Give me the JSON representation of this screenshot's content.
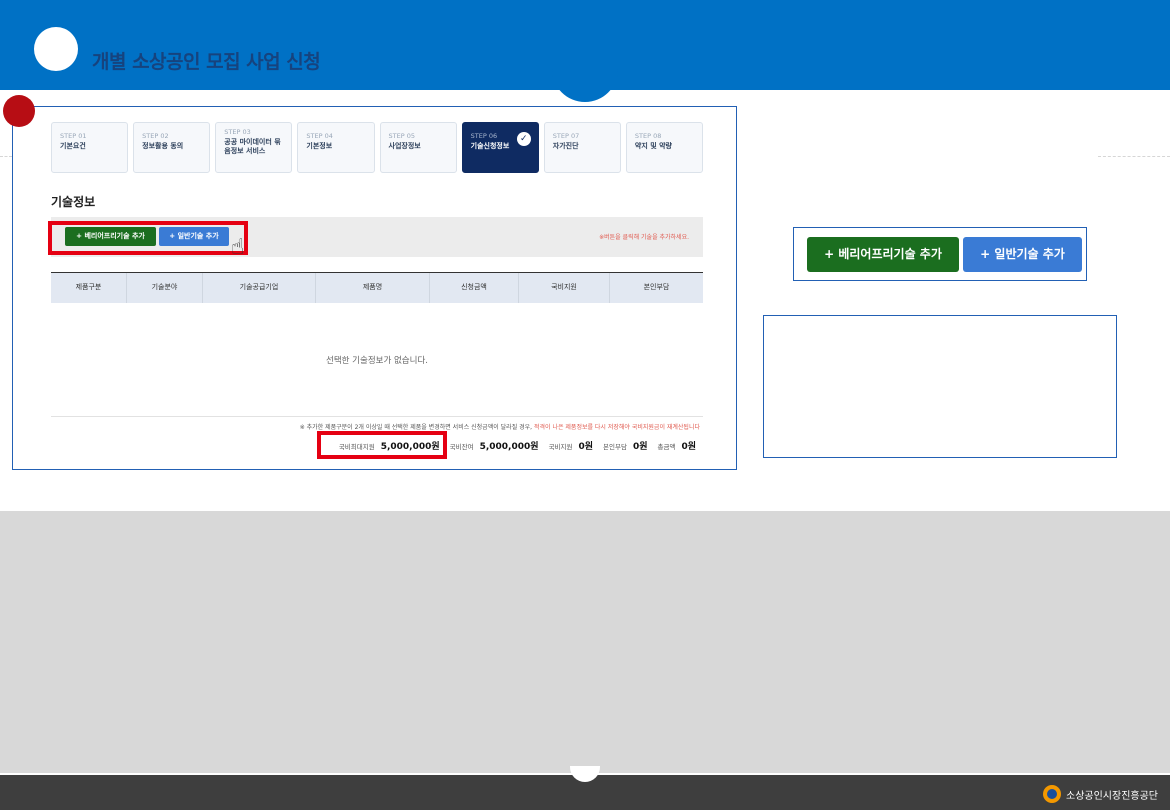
{
  "header": {
    "title": "개별 소상공인 모집 사업 신청"
  },
  "steps": [
    {
      "num": "STEP 01",
      "label": "기본요건"
    },
    {
      "num": "STEP 02",
      "label": "정보활용 동의"
    },
    {
      "num": "STEP 03",
      "label": "공공 마이데이터 묶음정보 서비스"
    },
    {
      "num": "STEP 04",
      "label": "기본정보"
    },
    {
      "num": "STEP 05",
      "label": "사업장정보"
    },
    {
      "num": "STEP 06",
      "label": "기술신청정보"
    },
    {
      "num": "STEP 07",
      "label": "자가진단"
    },
    {
      "num": "STEP 08",
      "label": "약지 및 약량"
    }
  ],
  "section": {
    "title": "기술정보",
    "barrier_free_button": "+ 베리어프리기술 추가",
    "general_button": "+ 일반기술 추가",
    "bar_note": "※버튼을 클릭해 기술을 추가하세요."
  },
  "table": {
    "columns": [
      "제품구분",
      "기술분야",
      "기술공급기업",
      "제품명",
      "신청금액",
      "국비지원",
      "본인부담"
    ],
    "empty_message": "선택한 기술정보가 없습니다."
  },
  "footnote": {
    "text": "※ 추가한 제품구분이 2개 이상일 때 선택한 제품을 변경하면 서비스 신청금액이 달라질 경우, ",
    "warning": "적격이 나은 제품정보를 다시 저장해야 국비지원금이 재계산됩니다"
  },
  "totals": {
    "max_support_label": "국비최대지원",
    "max_support_value": "5,000,000원",
    "balance_label": "국비잔여",
    "balance_value": "5,000,000원",
    "gov_support_label": "국비지원",
    "gov_support_value": "0원",
    "self_pay_label": "본인부담",
    "self_pay_value": "0원",
    "total_label": "총금액",
    "total_value": "0원"
  },
  "zoom": {
    "barrier_free_button": "+ 베리어프리기술 추가",
    "general_button": "+ 일반기술 추가"
  },
  "footer": {
    "brand": "소상공인시장진흥공단"
  },
  "colors": {
    "header_blue": "#0071c5",
    "active_step": "#0f2b62",
    "green_button": "#1b6e1f",
    "blue_button": "#3a7bd5",
    "highlight_red": "#e50012"
  }
}
